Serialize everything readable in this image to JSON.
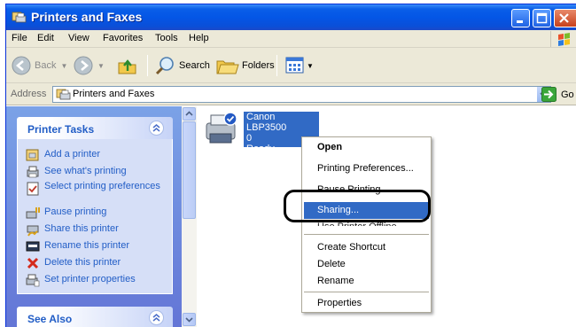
{
  "window": {
    "title": "Printers and Faxes",
    "colors": {
      "titlebar": "#0a5ee8",
      "taskpane": "#7ba2e7",
      "highlight": "#316ac5"
    }
  },
  "menu": {
    "items": [
      "File",
      "Edit",
      "View",
      "Favorites",
      "Tools",
      "Help"
    ]
  },
  "toolbar": {
    "back_label": "Back",
    "search_label": "Search",
    "folders_label": "Folders"
  },
  "address": {
    "label": "Address",
    "value": "Printers and Faxes",
    "go_label": "Go"
  },
  "taskpane": {
    "printer_tasks": {
      "title": "Printer Tasks",
      "items": [
        {
          "label": "Add a printer",
          "icon": "add-printer-icon"
        },
        {
          "label": "See what's printing",
          "icon": "print-queue-icon"
        },
        {
          "label": "Select printing preferences",
          "icon": "preferences-icon"
        },
        {
          "label": "Pause printing",
          "icon": "pause-printing-icon"
        },
        {
          "label": "Share this printer",
          "icon": "share-printer-icon"
        },
        {
          "label": "Rename this printer",
          "icon": "rename-printer-icon"
        },
        {
          "label": "Delete this printer",
          "icon": "delete-icon"
        },
        {
          "label": "Set printer properties",
          "icon": "printer-properties-icon"
        }
      ]
    },
    "see_also": {
      "title": "See Also"
    }
  },
  "printer": {
    "name": "Canon LBP3500",
    "jobs": "0",
    "status": "Ready"
  },
  "context_menu": {
    "items": [
      {
        "label": "Open",
        "bold": true
      },
      {
        "label": "Printing Preferences..."
      },
      {
        "label": "Pause Printing"
      },
      {
        "label": "Sharing...",
        "highlighted": true
      },
      {
        "label": "Use Printer Offline"
      },
      {
        "label": "Create Shortcut"
      },
      {
        "label": "Delete"
      },
      {
        "label": "Rename"
      },
      {
        "label": "Properties"
      }
    ]
  }
}
